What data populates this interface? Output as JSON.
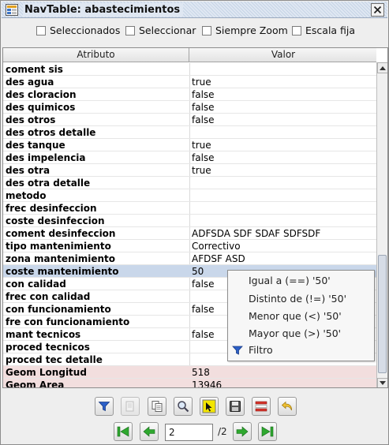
{
  "window": {
    "title": "NavTable: abastecimientos"
  },
  "options": [
    {
      "label": "Seleccionados",
      "checked": false
    },
    {
      "label": "Seleccionar",
      "checked": false
    },
    {
      "label": "Siempre Zoom",
      "checked": false
    },
    {
      "label": "Escala fija",
      "checked": false
    }
  ],
  "table": {
    "headers": {
      "attr": "Atributo",
      "value": "Valor"
    },
    "rows": [
      {
        "attr": "coment sis",
        "value": ""
      },
      {
        "attr": "des agua",
        "value": "true"
      },
      {
        "attr": "des cloracion",
        "value": "false"
      },
      {
        "attr": "des quimicos",
        "value": "false"
      },
      {
        "attr": "des otros",
        "value": "false"
      },
      {
        "attr": "des otros detalle",
        "value": ""
      },
      {
        "attr": "des tanque",
        "value": "true"
      },
      {
        "attr": "des impelencia",
        "value": "false"
      },
      {
        "attr": "des otra",
        "value": "true"
      },
      {
        "attr": "des otra detalle",
        "value": ""
      },
      {
        "attr": "metodo",
        "value": ""
      },
      {
        "attr": "frec desinfeccion",
        "value": ""
      },
      {
        "attr": "coste desinfeccion",
        "value": ""
      },
      {
        "attr": "coment desinfeccion",
        "value": "ADFSDA SDF SDAF SDFSDF"
      },
      {
        "attr": "tipo mantenimiento",
        "value": "Correctivo"
      },
      {
        "attr": "zona mantenimiento",
        "value": "AFDSF ASD"
      },
      {
        "attr": "coste mantenimiento",
        "value": "50"
      },
      {
        "attr": "con calidad",
        "value": "false"
      },
      {
        "attr": "frec con calidad",
        "value": ""
      },
      {
        "attr": "con funcionamiento",
        "value": "false"
      },
      {
        "attr": "fre con funcionamiento",
        "value": ""
      },
      {
        "attr": "mant tecnicos",
        "value": "false"
      },
      {
        "attr": "proced tecnicos",
        "value": ""
      },
      {
        "attr": "proced tec detalle",
        "value": ""
      },
      {
        "attr": "Geom Longitud",
        "value": "518"
      },
      {
        "attr": "Geom Area",
        "value": "13946"
      }
    ]
  },
  "context_menu": {
    "items": [
      {
        "label": "Igual a (==) '50'"
      },
      {
        "label": "Distinto de (!=) '50'"
      },
      {
        "label": "Menor que (<) '50'"
      },
      {
        "label": "Mayor que (>) '50'"
      },
      {
        "label": "Filtro",
        "icon": "filter-icon"
      }
    ]
  },
  "navigation": {
    "current_page": "2",
    "total": "/2"
  },
  "colors": {
    "selected_row": "#c9d7ea",
    "geom_row": "#f2dede",
    "accent_green": "#2ea82e"
  }
}
